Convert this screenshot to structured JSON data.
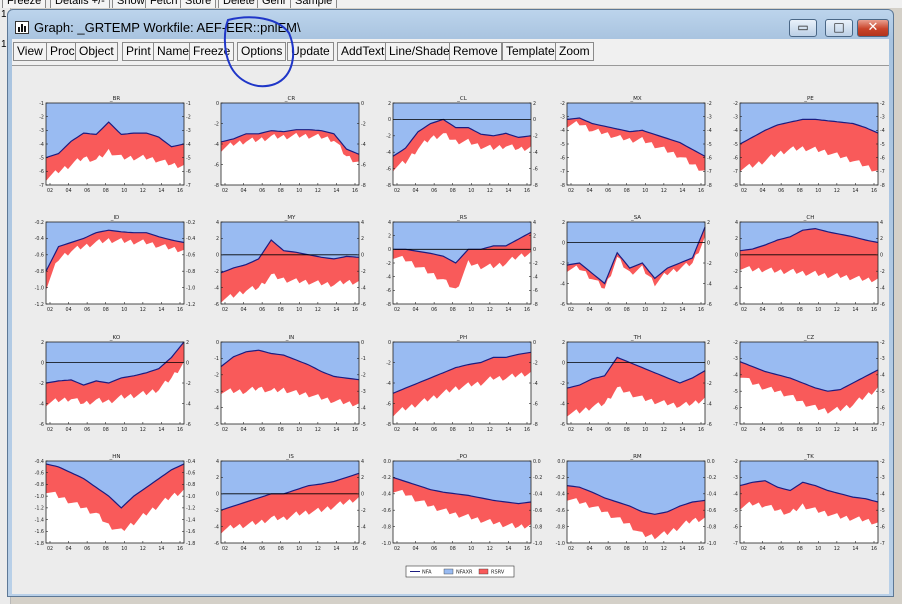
{
  "background": {
    "buttons": [
      "Freeze",
      "Details +/-",
      "Show",
      "Fetch",
      "Store",
      "Delete",
      "Genr",
      "Sample"
    ],
    "side_marks": [
      "1",
      "1"
    ]
  },
  "window": {
    "title": "Graph: _GRTEMP   Workfile: AEF-EER::pnlEM\\",
    "minimize_label": "▭",
    "maximize_label": "□",
    "close_label": "✕"
  },
  "toolbar": {
    "buttons": [
      "View",
      "Proc",
      "Object",
      "Print",
      "Name",
      "Freeze",
      "Options",
      "Update",
      "AddText",
      "Line/Shade",
      "Remove",
      "Template",
      "Zoom"
    ]
  },
  "colors": {
    "upper_fill": "#99bbf2",
    "lower_fill": "#f95a5a",
    "line": "#1c1c80",
    "annotation": "#1f36c8"
  },
  "legend": {
    "items": [
      {
        "label": "NFA",
        "type": "line",
        "color": "#1c1c80"
      },
      {
        "label": "NFAXR",
        "type": "box",
        "color": "#99bbf2"
      },
      {
        "label": "RSRV",
        "type": "box",
        "color": "#f95a5a"
      }
    ]
  },
  "chart_data": [
    {
      "title": "_BR",
      "type": "area",
      "x_ticks": [
        "02",
        "04",
        "06",
        "08",
        "10",
        "12",
        "14",
        "16"
      ],
      "ylim": [
        -7,
        -1
      ],
      "y_ticks": [
        "-1",
        "-2",
        "-3",
        "-4",
        "-5",
        "-6",
        "-7"
      ],
      "upper": [
        -5,
        -4.7,
        -3.8,
        -3.2,
        -3.3,
        -2.4,
        -3.3,
        -3.2,
        -3.2,
        -3.5,
        -4.2,
        -4.0
      ],
      "lower": [
        -6.5,
        -6.0,
        -5.5,
        -5.0,
        -5.2,
        -4.5,
        -5.0,
        -5.0,
        -5.0,
        -5.2,
        -5.5,
        -5.6
      ],
      "zero": false
    },
    {
      "title": "_CR",
      "type": "area",
      "x_ticks": [
        "02",
        "04",
        "06",
        "08",
        "10",
        "12",
        "14",
        "16"
      ],
      "ylim": [
        -8,
        0
      ],
      "y_ticks": [
        "0",
        "-2",
        "-4",
        "-6",
        "-8"
      ],
      "upper": [
        -3.8,
        -3.5,
        -3.0,
        -3.0,
        -2.7,
        -2.8,
        -2.6,
        -2.6,
        -2.7,
        -3.0,
        -4.5,
        -5.0
      ],
      "lower": [
        -4.5,
        -4.0,
        -3.7,
        -3.6,
        -3.3,
        -3.3,
        -3.2,
        -3.2,
        -3.3,
        -3.6,
        -5.2,
        -5.8
      ],
      "zero": false
    },
    {
      "title": "_CL",
      "type": "area",
      "x_ticks": [
        "02",
        "04",
        "06",
        "08",
        "10",
        "12",
        "14",
        "16"
      ],
      "ylim": [
        -8,
        2
      ],
      "y_ticks": [
        "2",
        "0",
        "-2",
        "-4",
        "-6",
        "-8"
      ],
      "upper": [
        -4.5,
        -3.5,
        -1.5,
        -0.5,
        0.0,
        -1.0,
        -1.0,
        -1.8,
        -2.0,
        -1.7,
        -2.2,
        -2.0
      ],
      "lower": [
        -6.0,
        -5.2,
        -3.5,
        -2.3,
        -1.8,
        -2.7,
        -2.7,
        -3.3,
        -3.5,
        -3.2,
        -3.6,
        -3.4
      ],
      "zero": true
    },
    {
      "title": "_MX",
      "type": "area",
      "x_ticks": [
        "02",
        "04",
        "06",
        "08",
        "10",
        "12",
        "14",
        "16"
      ],
      "ylim": [
        -8,
        -2
      ],
      "y_ticks": [
        "-2",
        "-3",
        "-4",
        "-5",
        "-6",
        "-7",
        "-8"
      ],
      "upper": [
        -3.2,
        -3.1,
        -3.5,
        -3.7,
        -3.9,
        -4.1,
        -4.0,
        -4.3,
        -4.6,
        -4.9,
        -5.4,
        -5.9
      ],
      "lower": [
        -3.6,
        -3.5,
        -4.0,
        -4.2,
        -4.5,
        -4.7,
        -4.7,
        -5.1,
        -5.5,
        -5.9,
        -6.5,
        -7.0
      ],
      "zero": false
    },
    {
      "title": "_PE",
      "type": "area",
      "x_ticks": [
        "02",
        "04",
        "06",
        "08",
        "10",
        "12",
        "14",
        "16"
      ],
      "ylim": [
        -8,
        -2
      ],
      "y_ticks": [
        "-2",
        "-3",
        "-4",
        "-5",
        "-6",
        "-7",
        "-8"
      ],
      "upper": [
        -5.0,
        -4.5,
        -4.0,
        -3.6,
        -3.4,
        -3.2,
        -3.2,
        -3.3,
        -3.4,
        -3.5,
        -3.8,
        -4.2
      ],
      "lower": [
        -6.8,
        -6.6,
        -6.2,
        -5.7,
        -5.4,
        -5.3,
        -5.4,
        -5.6,
        -5.9,
        -6.2,
        -6.6,
        -7.0
      ],
      "zero": false
    },
    {
      "title": "_ID",
      "type": "area",
      "x_ticks": [
        "02",
        "04",
        "06",
        "08",
        "10",
        "12",
        "14",
        "16"
      ],
      "ylim": [
        -1.2,
        -0.2
      ],
      "y_ticks": [
        "-0.2",
        "-0.4",
        "-0.6",
        "-0.8",
        "-1.0",
        "-1.2"
      ],
      "upper": [
        -0.8,
        -0.5,
        -0.45,
        -0.4,
        -0.33,
        -0.3,
        -0.32,
        -0.33,
        -0.33,
        -0.38,
        -0.42,
        -0.45
      ],
      "lower": [
        -1.0,
        -0.65,
        -0.55,
        -0.5,
        -0.45,
        -0.42,
        -0.43,
        -0.44,
        -0.45,
        -0.49,
        -0.52,
        -0.55
      ],
      "zero": false
    },
    {
      "title": "_MY",
      "type": "area",
      "x_ticks": [
        "02",
        "04",
        "06",
        "08",
        "10",
        "12",
        "14",
        "16"
      ],
      "ylim": [
        -6,
        4
      ],
      "y_ticks": [
        "4",
        "2",
        "0",
        "-2",
        "-4",
        "-6"
      ],
      "upper": [
        -2.2,
        -1.6,
        -1.2,
        -0.5,
        1.8,
        0.5,
        0.3,
        0.0,
        -0.3,
        -0.5,
        -0.2,
        -0.3
      ],
      "lower": [
        -5.5,
        -5.0,
        -4.3,
        -4.0,
        -2.5,
        -3.0,
        -3.2,
        -3.3,
        -3.5,
        -3.6,
        -3.3,
        -3.3
      ],
      "zero": true
    },
    {
      "title": "_RS",
      "type": "area",
      "x_ticks": [
        "02",
        "04",
        "06",
        "08",
        "10",
        "12",
        "14",
        "16"
      ],
      "ylim": [
        -8,
        4
      ],
      "y_ticks": [
        "4",
        "2",
        "0",
        "-2",
        "-4",
        "-6",
        "-8"
      ],
      "upper": [
        0,
        0,
        -0.3,
        -0.6,
        -1.0,
        -2.0,
        0,
        0,
        0.5,
        0.5,
        1.5,
        2.5
      ],
      "lower": [
        -1.0,
        -1.5,
        -2.5,
        -3.5,
        -4.5,
        -6.0,
        -2.0,
        -2.5,
        -2.5,
        -2.0,
        -1.0,
        -0.5
      ],
      "zero": true
    },
    {
      "title": "_SA",
      "type": "area",
      "x_ticks": [
        "02",
        "04",
        "06",
        "08",
        "10",
        "12",
        "14",
        "16"
      ],
      "ylim": [
        -6,
        2
      ],
      "y_ticks": [
        "2",
        "0",
        "-2",
        "-4",
        "-6"
      ],
      "upper": [
        -2.2,
        -2.0,
        -3.0,
        -4.0,
        -1.0,
        -2.5,
        -2.0,
        -3.5,
        -2.5,
        -2.0,
        -1.5,
        1.5
      ],
      "lower": [
        -2.6,
        -2.5,
        -3.5,
        -4.5,
        -1.5,
        -3.0,
        -2.5,
        -4.0,
        -3.0,
        -2.5,
        -2.0,
        0.5
      ],
      "zero": true
    },
    {
      "title": "_CH",
      "type": "area",
      "x_ticks": [
        "02",
        "04",
        "06",
        "08",
        "10",
        "12",
        "14",
        "16"
      ],
      "ylim": [
        -6,
        4
      ],
      "y_ticks": [
        "4",
        "2",
        "0",
        "-2",
        "-4",
        "-6"
      ],
      "upper": [
        0.5,
        0.7,
        1.2,
        1.8,
        2.2,
        3.0,
        3.2,
        2.8,
        2.5,
        2.2,
        1.8,
        1.5
      ],
      "lower": [
        -1.5,
        -1.8,
        -1.8,
        -2.0,
        -2.0,
        -2.2,
        -2.3,
        -2.5,
        -2.6,
        -2.8,
        -3.0,
        -3.0
      ],
      "zero": true
    },
    {
      "title": "_KO",
      "type": "area",
      "x_ticks": [
        "02",
        "04",
        "06",
        "08",
        "10",
        "12",
        "14",
        "16"
      ],
      "ylim": [
        -6,
        2
      ],
      "y_ticks": [
        "2",
        "0",
        "-2",
        "-4",
        "-6"
      ],
      "upper": [
        -2.0,
        -1.8,
        -1.7,
        -2.2,
        -1.8,
        -2.0,
        -1.5,
        -1.3,
        -1.0,
        -0.6,
        0.5,
        2.0
      ],
      "lower": [
        -4.0,
        -3.7,
        -3.5,
        -4.0,
        -3.7,
        -3.8,
        -3.4,
        -3.2,
        -3.0,
        -2.6,
        -1.5,
        0.0
      ],
      "zero": true
    },
    {
      "title": "_IN",
      "type": "area",
      "x_ticks": [
        "02",
        "04",
        "06",
        "08",
        "10",
        "12",
        "14",
        "16"
      ],
      "ylim": [
        -5,
        0
      ],
      "y_ticks": [
        "0",
        "-1",
        "-2",
        "-3",
        "-4",
        "-5"
      ],
      "upper": [
        -1.5,
        -0.9,
        -0.6,
        -0.5,
        -0.7,
        -0.8,
        -1.1,
        -1.4,
        -1.8,
        -2.1,
        -2.2,
        -2.3
      ],
      "lower": [
        -3.0,
        -3.0,
        -3.0,
        -2.8,
        -3.0,
        -2.9,
        -3.1,
        -3.2,
        -3.4,
        -3.6,
        -3.7,
        -3.8
      ],
      "zero": false
    },
    {
      "title": "_PH",
      "type": "area",
      "x_ticks": [
        "02",
        "04",
        "06",
        "08",
        "10",
        "12",
        "14",
        "16"
      ],
      "ylim": [
        -8,
        0
      ],
      "y_ticks": [
        "0",
        "-2",
        "-4",
        "-6",
        "-8"
      ],
      "upper": [
        -5.0,
        -4.5,
        -4.0,
        -3.5,
        -3.0,
        -2.5,
        -2.2,
        -2.0,
        -1.5,
        -1.5,
        -1.2,
        -1.0
      ],
      "lower": [
        -7.0,
        -6.5,
        -6.0,
        -5.5,
        -5.0,
        -4.5,
        -4.2,
        -4.0,
        -3.5,
        -3.5,
        -3.2,
        -3.0
      ],
      "zero": false
    },
    {
      "title": "_TH",
      "type": "area",
      "x_ticks": [
        "02",
        "04",
        "06",
        "08",
        "10",
        "12",
        "14",
        "16"
      ],
      "ylim": [
        -6,
        2
      ],
      "y_ticks": [
        "2",
        "0",
        "-2",
        "-4",
        "-6"
      ],
      "upper": [
        -2.5,
        -2.2,
        -1.6,
        -1.3,
        0.5,
        0.0,
        -0.5,
        -1.0,
        -1.5,
        -2.0,
        -1.5,
        -0.8
      ],
      "lower": [
        -5.0,
        -4.8,
        -4.3,
        -4.0,
        -2.5,
        -3.0,
        -3.5,
        -3.8,
        -4.0,
        -4.2,
        -4.0,
        -3.5
      ],
      "zero": true
    },
    {
      "title": "_CZ",
      "type": "area",
      "x_ticks": [
        "02",
        "04",
        "06",
        "08",
        "10",
        "12",
        "14",
        "16"
      ],
      "ylim": [
        -7,
        -2
      ],
      "y_ticks": [
        "-2",
        "-3",
        "-4",
        "-5",
        "-6",
        "-7"
      ],
      "upper": [
        -3.2,
        -3.5,
        -3.8,
        -4.0,
        -4.2,
        -4.5,
        -4.8,
        -5.0,
        -4.9,
        -4.5,
        -4.1,
        -3.7
      ],
      "lower": [
        -4.0,
        -4.5,
        -4.8,
        -5.0,
        -5.3,
        -5.7,
        -6.0,
        -6.2,
        -6.1,
        -5.8,
        -5.3,
        -4.8
      ],
      "zero": false
    },
    {
      "title": "_HN",
      "type": "area",
      "x_ticks": [
        "02",
        "04",
        "06",
        "08",
        "10",
        "12",
        "14",
        "16"
      ],
      "ylim": [
        -1.8,
        -0.4
      ],
      "y_ticks": [
        "-0.4",
        "-0.6",
        "-0.8",
        "-1.0",
        "-1.2",
        "-1.4",
        "-1.6",
        "-1.8"
      ],
      "upper": [
        -0.45,
        -0.5,
        -0.6,
        -0.7,
        -0.85,
        -1.0,
        -1.2,
        -1.0,
        -0.85,
        -0.7,
        -0.55,
        -0.45
      ],
      "lower": [
        -0.9,
        -1.0,
        -1.1,
        -1.2,
        -1.3,
        -1.5,
        -1.6,
        -1.45,
        -1.3,
        -1.15,
        -1.0,
        -0.9
      ],
      "zero": false
    },
    {
      "title": "_IS",
      "type": "area",
      "x_ticks": [
        "02",
        "04",
        "06",
        "08",
        "10",
        "12",
        "14",
        "16"
      ],
      "ylim": [
        -6,
        4
      ],
      "y_ticks": [
        "4",
        "2",
        "0",
        "-2",
        "-4",
        "-6"
      ],
      "upper": [
        -2.0,
        -1.5,
        -1.0,
        -0.5,
        0.0,
        0.0,
        0.5,
        1.0,
        1.2,
        1.5,
        2.0,
        2.5
      ],
      "lower": [
        -4.5,
        -4.0,
        -3.8,
        -3.5,
        -3.0,
        -3.0,
        -2.5,
        -2.2,
        -2.0,
        -1.5,
        -1.0,
        -0.5
      ],
      "zero": true
    },
    {
      "title": "_PO",
      "type": "area",
      "x_ticks": [
        "02",
        "04",
        "06",
        "08",
        "10",
        "12",
        "14",
        "16"
      ],
      "ylim": [
        -1.0,
        0.0
      ],
      "y_ticks": [
        "0.0",
        "-0.2",
        "-0.4",
        "-0.6",
        "-0.8",
        "-1.0"
      ],
      "upper": [
        -0.2,
        -0.25,
        -0.3,
        -0.35,
        -0.38,
        -0.4,
        -0.42,
        -0.45,
        -0.48,
        -0.5,
        -0.52,
        -0.5
      ],
      "lower": [
        -0.35,
        -0.4,
        -0.48,
        -0.55,
        -0.6,
        -0.65,
        -0.68,
        -0.72,
        -0.75,
        -0.78,
        -0.8,
        -0.78
      ],
      "zero": false
    },
    {
      "title": "_RM",
      "type": "area",
      "x_ticks": [
        "02",
        "04",
        "06",
        "08",
        "10",
        "12",
        "14",
        "16"
      ],
      "ylim": [
        -1.0,
        0.0
      ],
      "y_ticks": [
        "0.0",
        "-0.2",
        "-0.4",
        "-0.6",
        "-0.8",
        "-1.0"
      ],
      "upper": [
        -0.3,
        -0.32,
        -0.38,
        -0.45,
        -0.5,
        -0.55,
        -0.62,
        -0.65,
        -0.62,
        -0.55,
        -0.5,
        -0.48
      ],
      "lower": [
        -0.45,
        -0.5,
        -0.55,
        -0.62,
        -0.7,
        -0.78,
        -0.9,
        -0.92,
        -0.88,
        -0.8,
        -0.72,
        -0.7
      ],
      "zero": false
    },
    {
      "title": "_TK",
      "type": "area",
      "x_ticks": [
        "02",
        "04",
        "06",
        "08",
        "10",
        "12",
        "14",
        "16"
      ],
      "ylim": [
        -7,
        -2
      ],
      "y_ticks": [
        "-2",
        "-3",
        "-4",
        "-5",
        "-6",
        "-7"
      ],
      "upper": [
        -3.5,
        -3.3,
        -3.2,
        -3.6,
        -3.8,
        -3.3,
        -3.5,
        -3.8,
        -4.0,
        -4.2,
        -4.3,
        -4.5
      ],
      "lower": [
        -4.8,
        -4.6,
        -4.7,
        -5.0,
        -5.2,
        -4.7,
        -5.0,
        -5.2,
        -5.4,
        -5.5,
        -5.6,
        -5.8
      ],
      "zero": false
    }
  ]
}
